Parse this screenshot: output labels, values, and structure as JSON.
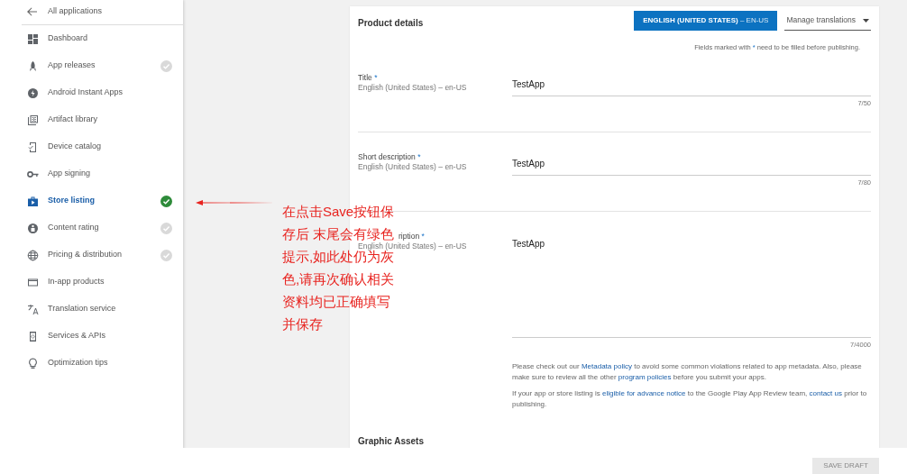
{
  "sidebar": {
    "back": {
      "label": "All applications"
    },
    "items": [
      {
        "label": "Dashboard",
        "selected": false
      },
      {
        "label": "App releases",
        "selected": false,
        "completed": false
      },
      {
        "label": "Android Instant Apps",
        "selected": false
      },
      {
        "label": "Artifact library",
        "selected": false
      },
      {
        "label": "Device catalog",
        "selected": false
      },
      {
        "label": "App signing",
        "selected": false
      },
      {
        "label": "Store listing",
        "selected": true,
        "completed": true
      },
      {
        "label": "Content rating",
        "selected": false,
        "completed": false
      },
      {
        "label": "Pricing & distribution",
        "selected": false,
        "completed": false
      },
      {
        "label": "In-app products",
        "selected": false
      },
      {
        "label": "Translation service",
        "selected": false
      },
      {
        "label": "Services & APIs",
        "selected": false
      },
      {
        "label": "Optimization tips",
        "selected": false
      }
    ]
  },
  "card": {
    "title": "Product details",
    "language_button": {
      "label": "ENGLISH (UNITED STATES)",
      "code": "– EN-US"
    },
    "manage_translations": "Manage translations",
    "hint": {
      "before": "Fields marked with",
      "mark": "*",
      "after": "need to be filled before publishing."
    },
    "fields": [
      {
        "label": "Title",
        "required": true,
        "locale": "English (United States) – en-US",
        "value": "TestApp",
        "counter": "7/50",
        "kind": "line"
      },
      {
        "label": "Short description",
        "required": true,
        "locale": "English (United States) – en-US",
        "value": "TestApp",
        "counter": "7/80",
        "kind": "line"
      },
      {
        "label": "ription",
        "required": true,
        "locale": "English (United States) – en-US",
        "value": "TestApp",
        "counter": "7/4000",
        "kind": "area"
      }
    ],
    "notes": [
      [
        {
          "text": "Please check out our "
        },
        {
          "text": "Metadata policy",
          "link": true
        },
        {
          "text": " to avoid some common violations related to app metadata. Also, please make sure to review all the other "
        },
        {
          "text": "program policies",
          "link": true
        },
        {
          "text": " before you submit your apps."
        }
      ],
      [
        {
          "text": "If your app or store listing is "
        },
        {
          "text": "eligible for advance notice",
          "link": true
        },
        {
          "text": " to the Google Play App Review team, "
        },
        {
          "text": "contact us",
          "link": true
        },
        {
          "text": " prior to publishing."
        }
      ]
    ],
    "next_section": "Graphic Assets"
  },
  "footer": {
    "save_button": "SAVE DRAFT"
  },
  "annotation": {
    "lines": [
      "在点击Save按钮保",
      "存后 末尾会有绿色",
      "提示,如此处仍为灰",
      "色,请再次确认相关",
      "资料均已正确填写",
      "并保存"
    ]
  }
}
